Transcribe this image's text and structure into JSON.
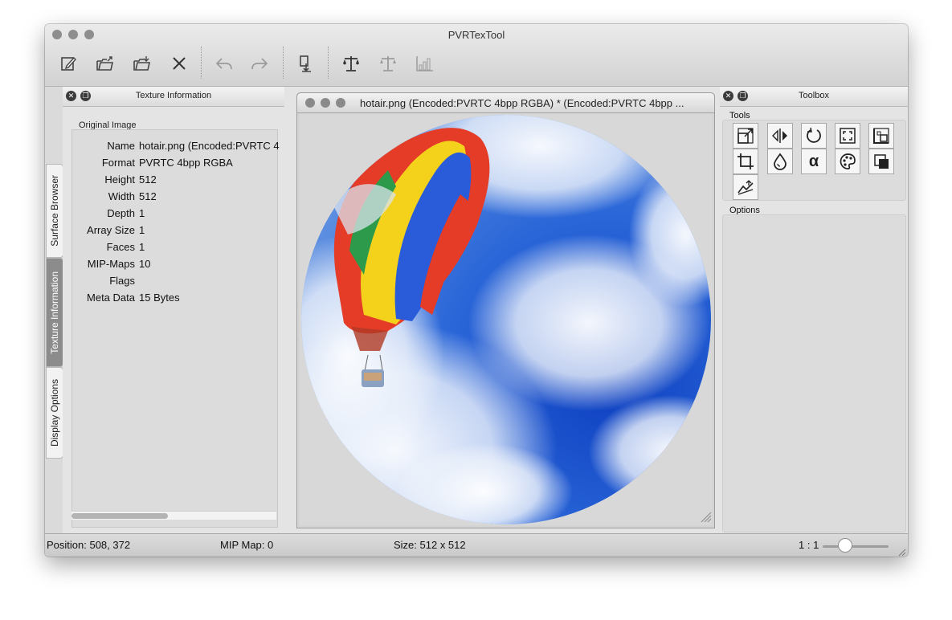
{
  "window": {
    "title": "PVRTexTool"
  },
  "toolbar": {
    "icons": [
      "new-icon",
      "open-icon",
      "open-encoded-icon",
      "close-icon",
      "undo-icon",
      "redo-icon",
      "encode-icon",
      "compare-icon",
      "compare-disabled-icon",
      "histogram-icon"
    ]
  },
  "side_tabs": [
    {
      "label": "Surface Browser"
    },
    {
      "label": "Texture Information"
    },
    {
      "label": "Display Options"
    }
  ],
  "texture_info": {
    "panel_title": "Texture Information",
    "group_label": "Original Image",
    "rows": [
      {
        "label": "Name",
        "value": "hotair.png (Encoded:PVRTC 4"
      },
      {
        "label": "Format",
        "value": "PVRTC 4bpp RGBA"
      },
      {
        "label": "Height",
        "value": "512"
      },
      {
        "label": "Width",
        "value": "512"
      },
      {
        "label": "Depth",
        "value": "1"
      },
      {
        "label": "Array Size",
        "value": "1"
      },
      {
        "label": "Faces",
        "value": "1"
      },
      {
        "label": "MIP-Maps",
        "value": "10"
      },
      {
        "label": "Flags",
        "value": ""
      },
      {
        "label": "Meta Data",
        "value": "15 Bytes"
      }
    ]
  },
  "document": {
    "title": "hotair.png (Encoded:PVRTC 4bpp RGBA) * (Encoded:PVRTC 4bpp ..."
  },
  "toolbox": {
    "panel_title": "Toolbox",
    "tools_label": "Tools",
    "options_label": "Options",
    "tools": [
      "resize-icon",
      "flip-icon",
      "rotate-icon",
      "border-icon",
      "generate-mipmaps-icon",
      "crop-icon",
      "colour-icon",
      "alpha-icon",
      "palette-icon",
      "premultiply-icon",
      "normal-map-icon"
    ]
  },
  "statusbar": {
    "position": "Position: 508, 372",
    "mipmap": "MIP Map: 0",
    "size": "Size: 512 x 512",
    "zoom": "1 : 1"
  }
}
